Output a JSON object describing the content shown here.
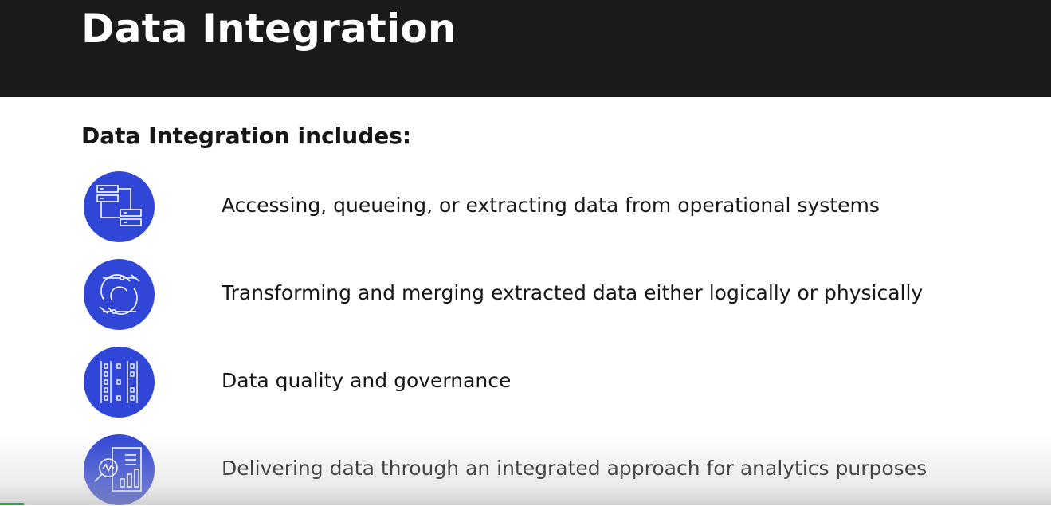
{
  "slide": {
    "title": "Data Integration",
    "subtitle": "Data Integration includes:",
    "accent_color": "#3046d6",
    "header_color": "#1a1a1a",
    "items": [
      {
        "icon": "data-flow-icon",
        "text": "Accessing, queueing, or extracting data from operational systems"
      },
      {
        "icon": "transform-cycle-icon",
        "text": "Transforming and merging extracted data either logically or physically"
      },
      {
        "icon": "data-quality-grid-icon",
        "text": "Data quality and governance"
      },
      {
        "icon": "analytics-report-icon",
        "text": "Delivering data through an integrated approach for analytics purposes"
      }
    ]
  }
}
